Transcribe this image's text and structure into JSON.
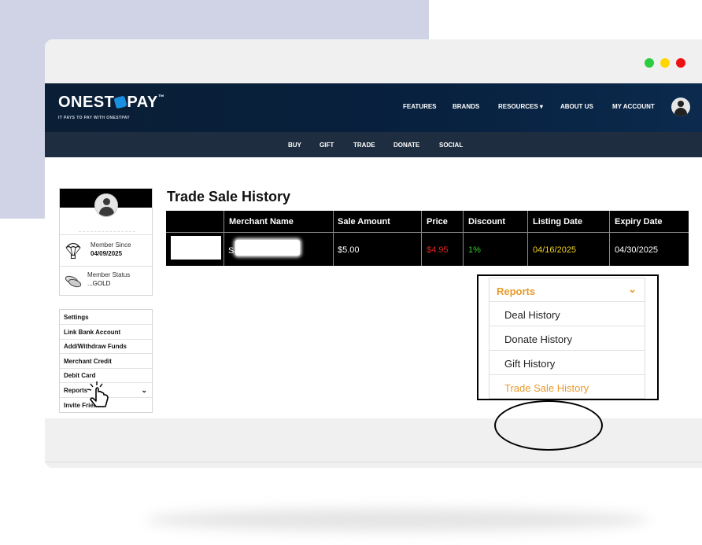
{
  "brand": {
    "logo_left": "ONEST",
    "logo_right": "PAY",
    "trademark": "™",
    "tagline": "IT PAYS TO PAY WITH ONESTPAY"
  },
  "colors": {
    "nav_bg": "#0a1e35",
    "subnav_bg": "#1e2d3f",
    "accent_orange": "#e79b2d",
    "price_red": "#e22222",
    "discount_green": "#2ed12e",
    "listing_yellow": "#f2d21d",
    "backdrop": "#d0d3e6",
    "window_green": "#2ecc40",
    "window_yellow": "#ffd600",
    "window_red": "#ee1111"
  },
  "topnav": {
    "items": [
      "FEATURES",
      "BRANDS",
      "RESOURCES ▾",
      "ABOUT US",
      "MY ACCOUNT"
    ],
    "avatar_icon": "user-avatar-icon"
  },
  "subnav": {
    "items": [
      "BUY",
      "GIFT",
      "TRADE",
      "DONATE",
      "SOCIAL"
    ]
  },
  "profile": {
    "member_since_label": "Member Since",
    "member_since_value": "04/09/2025",
    "member_status_label": "Member Status",
    "member_status_value": "...GOLD"
  },
  "sidebar_menu": {
    "items": [
      "Settings",
      "Link Bank Account",
      "Add/Withdraw Funds",
      "Merchant Credit",
      "Debit Card",
      "Reports",
      "Invite Friends"
    ],
    "reports_chevron": "⌄"
  },
  "page": {
    "title": "Trade Sale History"
  },
  "table": {
    "headers": [
      "",
      "Merchant Name",
      "Sale Amount",
      "Price",
      "Discount",
      "Listing Date",
      "Expiry Date"
    ],
    "rows": [
      {
        "merchant_prefix": "S",
        "sale_amount": "$5.00",
        "price": "$4.95",
        "discount": "1%",
        "listing_date": "04/16/2025",
        "expiry_date": "04/30/2025"
      }
    ]
  },
  "reports_dropdown": {
    "header": "Reports",
    "chevron": "⌄",
    "items": [
      "Deal History",
      "Donate History",
      "Gift History",
      "Trade Sale History"
    ],
    "active": "Trade Sale History"
  }
}
